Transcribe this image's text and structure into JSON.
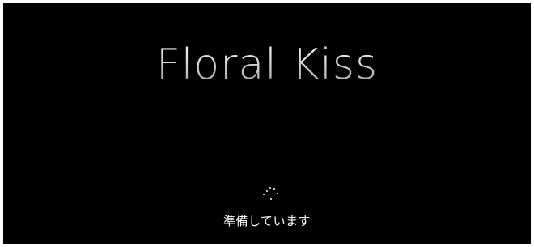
{
  "screen": {
    "background_color": "#000000",
    "logo_text": "Floral Kiss",
    "spinner_icon": "loading-dots-spinner-icon",
    "status_text": "準備しています"
  }
}
